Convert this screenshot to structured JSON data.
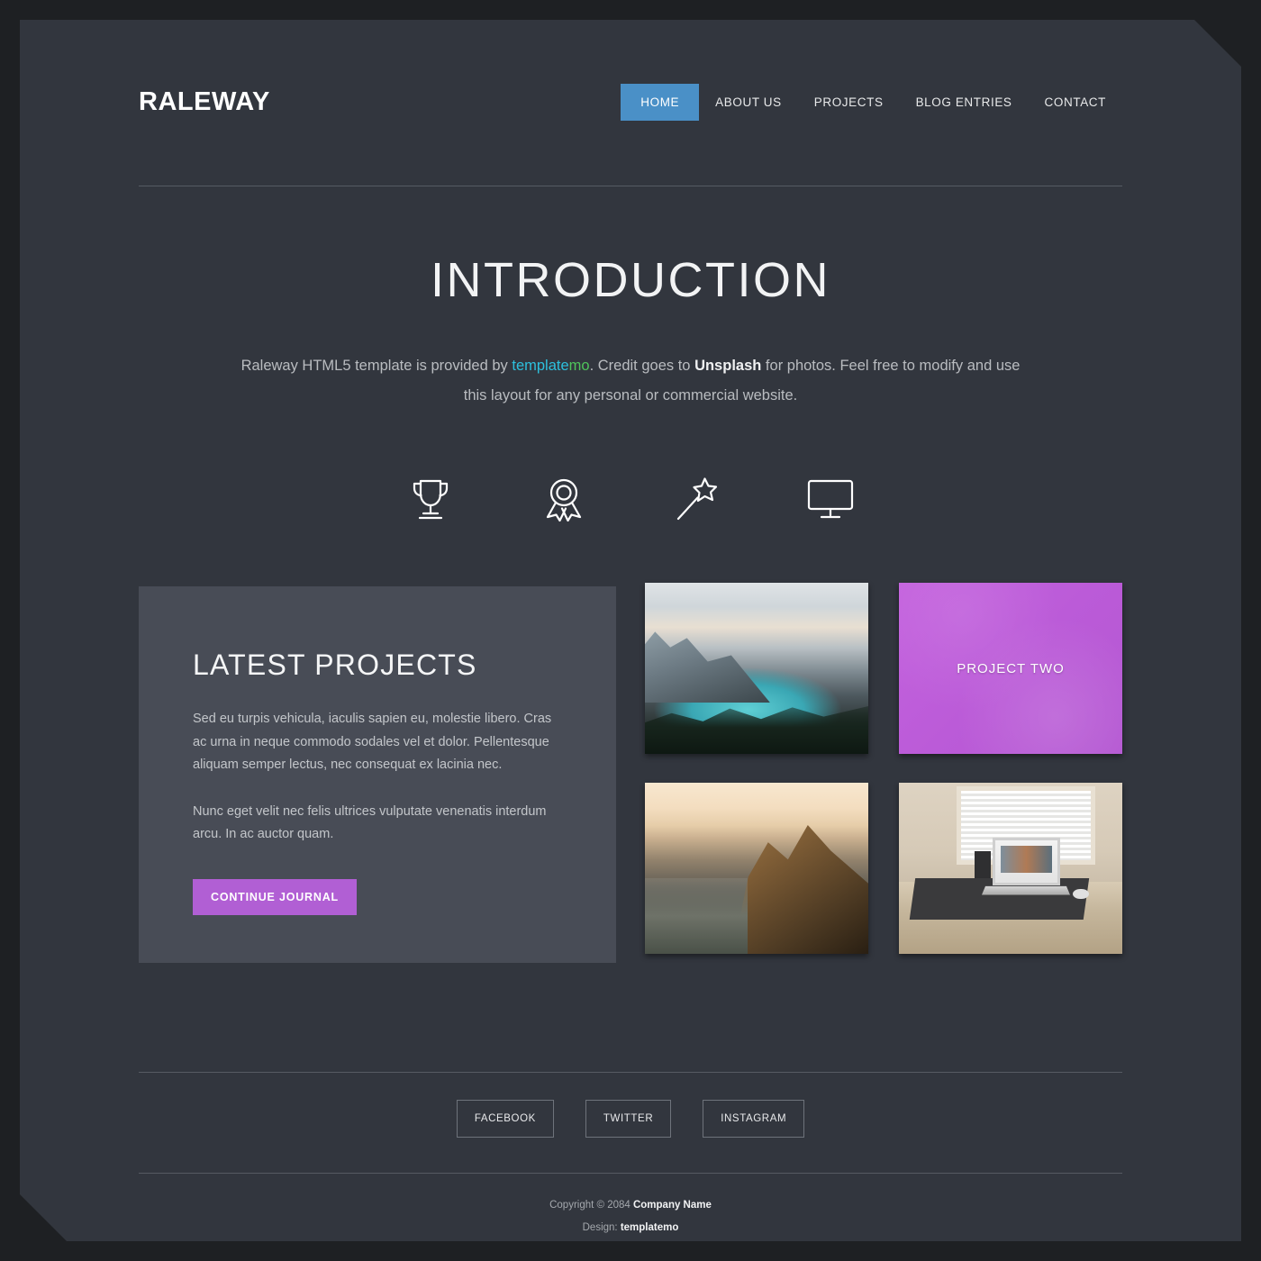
{
  "site": {
    "logo": "RALEWAY",
    "background_color": "#32363e",
    "outer_color": "#1e2023",
    "accent_blue": "#4a90c7",
    "accent_purple": "#b15fd4",
    "panel_color": "#484c56"
  },
  "nav": {
    "items": [
      {
        "label": "HOME",
        "active": true
      },
      {
        "label": "ABOUT US",
        "active": false
      },
      {
        "label": "PROJECTS",
        "active": false
      },
      {
        "label": "BLOG ENTRIES",
        "active": false
      },
      {
        "label": "CONTACT",
        "active": false
      }
    ]
  },
  "intro": {
    "title": "INTRODUCTION",
    "line1_pre": "Raleway HTML5 template is provided by ",
    "link_part1": "template",
    "link_part2": "mo",
    "line1_mid": ". Credit goes to ",
    "credit": "Unsplash",
    "line1_post": " for photos. Feel free to modify",
    "line2": "and use this layout for any personal or commercial website.",
    "link_color_1": "#2dc0dd",
    "link_color_2": "#4fc45b"
  },
  "features": {
    "icons": [
      {
        "name": "trophy-icon"
      },
      {
        "name": "award-ribbon-icon"
      },
      {
        "name": "magic-wand-icon"
      },
      {
        "name": "monitor-icon"
      }
    ]
  },
  "projects": {
    "panel_title": "LATEST PROJECTS",
    "paragraph1": "Sed eu turpis vehicula, iaculis sapien eu, molestie libero. Cras ac urna in neque commodo sodales vel et dolor. Pellentesque aliquam semper lectus, nec consequat ex lacinia nec.",
    "paragraph2": "Nunc eget velit nec felis ultrices vulputate venenatis interdum arcu. In ac auctor quam.",
    "cta_label": "CONTINUE JOURNAL",
    "thumbs": [
      {
        "name": "project-one-thumb",
        "label": "",
        "kind": "mountain-lake-photo"
      },
      {
        "name": "project-two-thumb",
        "label": "PROJECT TWO",
        "kind": "purple-overlay"
      },
      {
        "name": "project-three-thumb",
        "label": "",
        "kind": "coastal-cliff-photo"
      },
      {
        "name": "project-four-thumb",
        "label": "",
        "kind": "desk-laptop-photo"
      }
    ]
  },
  "footer": {
    "social": [
      {
        "label": "FACEBOOK"
      },
      {
        "label": "TWITTER"
      },
      {
        "label": "INSTAGRAM"
      }
    ],
    "copyright_pre": "Copyright © 2084 ",
    "copyright_company": "Company Name",
    "design_pre": "Design: ",
    "design_name": "templatemo"
  }
}
